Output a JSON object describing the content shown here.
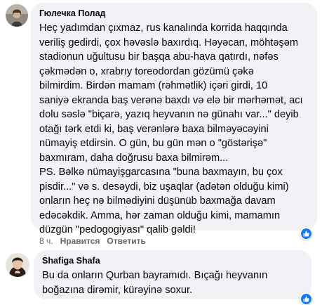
{
  "comment1": {
    "author": "Гюлечка Полад",
    "body_lines": [
      "Heç yadımdan çıxmaz, rus kanalında korrida haqqında",
      "veriliş gedirdi, çox həvəslə baxırdıq. Həyəcan, möhtəşəm",
      "stadionun uğultusu bir başqa abu-hava qatırdı, nəfəs",
      "çəkmədən o, xrabrıy toreodordan gözümü çəkə",
      "bilmirdim. Birdən mamam (rəhmətlik) içəri girdi, 10",
      "saniyə ekranda baş verənə baxdı və elə bir mərhəmət, acı",
      "dolu səslə \"biçarə, yazıq heyvanın nə günahı var...\" deyib",
      "otağı tərk etdi ki, baş verənlərə baxa bilməyəcəyini",
      "nümayiş etdirsin. O gün, bu gün mən o \"göstərişə\"",
      "baxmıram, daha doğrusu baxa bilmirəm...",
      "PS. Bəlkə nümayişgarcasına \"buna baxmayın, bu çox",
      "pisdir...\" və s. desəydi, biz uşaqlar (adətən olduğu kimi)",
      "onların heç nə bilmədiyini düşünüb baxmağa davam",
      "edəcəkdik. Amma, hər zaman olduğu kimi, mamamın",
      "düzgün \"pedogogiyası\" qalib gəldi!"
    ],
    "time": "8 ч.",
    "like_label": "Нравится",
    "reply_label": "Ответить",
    "reaction_icon": "like-icon"
  },
  "comment2": {
    "author": "Shafiga Shafa",
    "body_lines": [
      "Bu da onların Qurban bayramıdı. Bıçağı heyvanın",
      "boğazına dirəmir, kürəyinə soxur."
    ],
    "reaction_icon": "like-icon"
  },
  "colors": {
    "bubble_bg": "#f0f2f5",
    "meta_text": "#65676b",
    "like_blue": "#1877f2"
  }
}
